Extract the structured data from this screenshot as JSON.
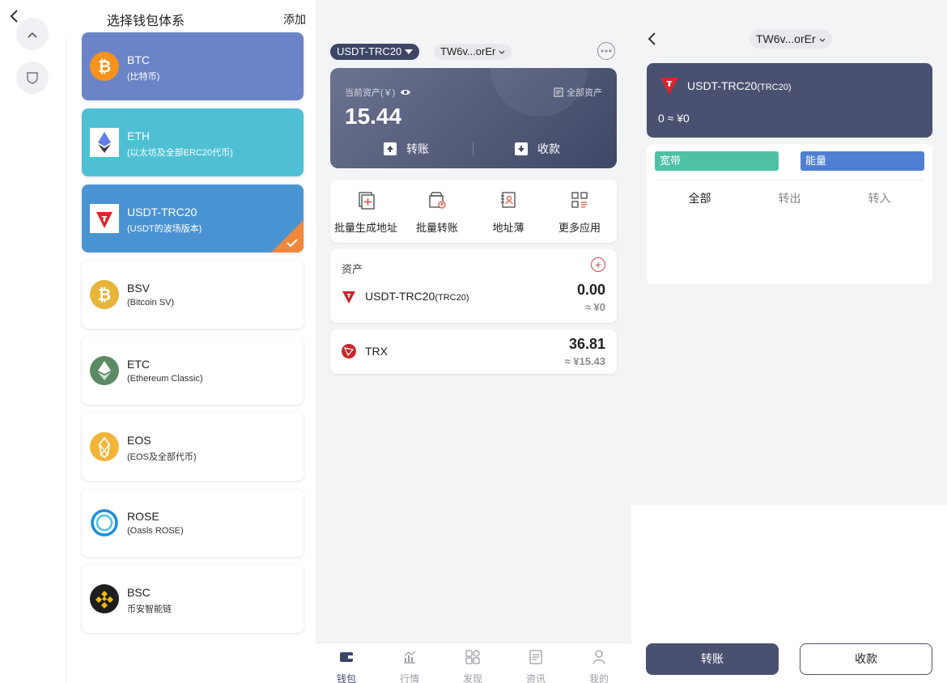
{
  "chooser": {
    "title": "选择钱包体系",
    "add_label": "添加",
    "chains": [
      {
        "name": "BTC",
        "sub": "(比特币)",
        "color": "#6b84c8",
        "logo": "bitcoin-icon",
        "logo_bg": "#f7931a"
      },
      {
        "name": "ETH",
        "sub": "(以太坊及全部ERC20代币)",
        "color": "#4fc0d3",
        "logo": "ethereum-icon",
        "logo_bg": "#ffffff"
      },
      {
        "name": "USDT-TRC20",
        "sub": "(USDT的波场版本)",
        "color": "#4a93d3",
        "logo": "tron-icon",
        "logo_bg": "#ffffff",
        "selected": true
      },
      {
        "name": "BSV",
        "sub": "(Bitcoin SV)",
        "logo": "bitcoin-sv-icon",
        "logo_bg": "#e8b53a"
      },
      {
        "name": "ETC",
        "sub": "(Ethereum Classic)",
        "logo": "ethereum-classic-icon",
        "logo_bg": "#5c8a64"
      },
      {
        "name": "EOS",
        "sub": "(EOS及全部代币)",
        "logo": "eos-icon",
        "logo_bg": "#f2b53a"
      },
      {
        "name": "ROSE",
        "sub": "(Oasls ROSE)",
        "logo": "rose-icon",
        "logo_bg": "#ffffff"
      },
      {
        "name": "BSC",
        "sub": "币安智能链",
        "logo": "bsc-icon",
        "logo_bg": "#1e1e1e"
      }
    ]
  },
  "wallet": {
    "chain_selector": "USDT-TRC20",
    "address": "TW6v...orEr",
    "asset_label": "当前资产(￥)",
    "all_assets_label": "全部资产",
    "total_value": "15.44",
    "send_label": "转账",
    "receive_label": "收款",
    "tools": [
      "批量生成地址",
      "批量转账",
      "地址薄",
      "更多应用"
    ],
    "assets_title": "资产",
    "assets": [
      {
        "name": "USDT-TRC20",
        "tag": "(TRC20)",
        "amount": "0.00",
        "fiat": "≈ ¥0"
      },
      {
        "name": "TRX",
        "tag": "",
        "amount": "36.81",
        "fiat": "≈ ¥15.43"
      }
    ],
    "tabs": [
      "钱包",
      "行情",
      "发现",
      "资讯",
      "我的"
    ]
  },
  "detail": {
    "address": "TW6v...orEr",
    "token_name": "USDT-TRC20",
    "token_tag": "(TRC20)",
    "balance": "0 ≈ ¥0",
    "bandwidth_label": "宽带",
    "energy_label": "能量",
    "tx_tabs": [
      "全部",
      "转出",
      "转入"
    ],
    "send_label": "转账",
    "receive_label": "收款"
  }
}
